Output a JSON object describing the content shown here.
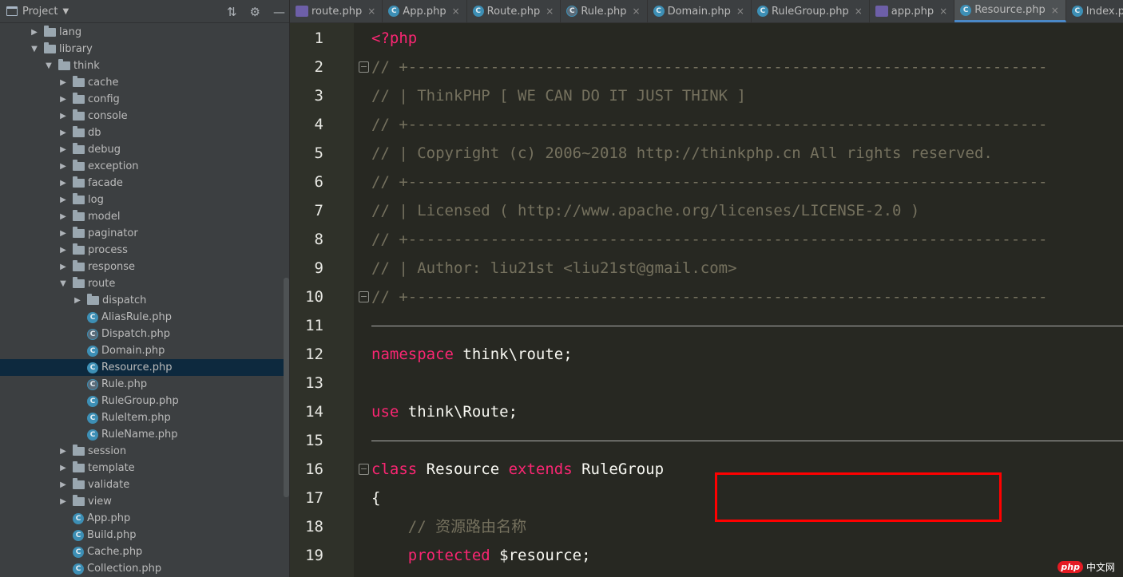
{
  "project": {
    "title": "Project",
    "tree": [
      {
        "label": "lang",
        "type": "folder",
        "depth": 0,
        "expanded": false
      },
      {
        "label": "library",
        "type": "folder",
        "depth": 0,
        "expanded": true
      },
      {
        "label": "think",
        "type": "folder",
        "depth": 1,
        "expanded": true
      },
      {
        "label": "cache",
        "type": "folder",
        "depth": 2,
        "expanded": false
      },
      {
        "label": "config",
        "type": "folder",
        "depth": 2,
        "expanded": false
      },
      {
        "label": "console",
        "type": "folder",
        "depth": 2,
        "expanded": false
      },
      {
        "label": "db",
        "type": "folder",
        "depth": 2,
        "expanded": false
      },
      {
        "label": "debug",
        "type": "folder",
        "depth": 2,
        "expanded": false
      },
      {
        "label": "exception",
        "type": "folder",
        "depth": 2,
        "expanded": false
      },
      {
        "label": "facade",
        "type": "folder",
        "depth": 2,
        "expanded": false
      },
      {
        "label": "log",
        "type": "folder",
        "depth": 2,
        "expanded": false
      },
      {
        "label": "model",
        "type": "folder",
        "depth": 2,
        "expanded": false
      },
      {
        "label": "paginator",
        "type": "folder",
        "depth": 2,
        "expanded": false
      },
      {
        "label": "process",
        "type": "folder",
        "depth": 2,
        "expanded": false
      },
      {
        "label": "response",
        "type": "folder",
        "depth": 2,
        "expanded": false
      },
      {
        "label": "route",
        "type": "folder",
        "depth": 2,
        "expanded": true
      },
      {
        "label": "dispatch",
        "type": "folder",
        "depth": 3,
        "expanded": false
      },
      {
        "label": "AliasRule.php",
        "type": "class",
        "depth": 3
      },
      {
        "label": "Dispatch.php",
        "type": "abstract",
        "depth": 3
      },
      {
        "label": "Domain.php",
        "type": "class",
        "depth": 3
      },
      {
        "label": "Resource.php",
        "type": "class",
        "depth": 3,
        "selected": true
      },
      {
        "label": "Rule.php",
        "type": "abstract",
        "depth": 3
      },
      {
        "label": "RuleGroup.php",
        "type": "class",
        "depth": 3
      },
      {
        "label": "RuleItem.php",
        "type": "class",
        "depth": 3
      },
      {
        "label": "RuleName.php",
        "type": "class",
        "depth": 3
      },
      {
        "label": "session",
        "type": "folder",
        "depth": 2,
        "expanded": false
      },
      {
        "label": "template",
        "type": "folder",
        "depth": 2,
        "expanded": false
      },
      {
        "label": "validate",
        "type": "folder",
        "depth": 2,
        "expanded": false
      },
      {
        "label": "view",
        "type": "folder",
        "depth": 2,
        "expanded": false
      },
      {
        "label": "App.php",
        "type": "class",
        "depth": 2
      },
      {
        "label": "Build.php",
        "type": "class",
        "depth": 2
      },
      {
        "label": "Cache.php",
        "type": "class",
        "depth": 2
      },
      {
        "label": "Collection.php",
        "type": "class",
        "depth": 2
      }
    ]
  },
  "tabs": [
    {
      "label": "route.php",
      "icon": "php"
    },
    {
      "label": "App.php",
      "icon": "class"
    },
    {
      "label": "Route.php",
      "icon": "class"
    },
    {
      "label": "Rule.php",
      "icon": "abstract"
    },
    {
      "label": "Domain.php",
      "icon": "class"
    },
    {
      "label": "RuleGroup.php",
      "icon": "class"
    },
    {
      "label": "app.php",
      "icon": "php"
    },
    {
      "label": "Resource.php",
      "icon": "class",
      "active": true
    },
    {
      "label": "Index.php",
      "icon": "class"
    }
  ],
  "tab_close_glyph": "×",
  "editor": {
    "lines": [
      {
        "n": "1",
        "tokens": [
          {
            "t": "<?php",
            "c": "kw"
          }
        ]
      },
      {
        "n": "2",
        "fold": true,
        "tokens": [
          {
            "t": "// +----------------------------------------------------------------------",
            "c": "comment"
          }
        ]
      },
      {
        "n": "3",
        "tokens": [
          {
            "t": "// | ThinkPHP [ WE CAN DO IT JUST THINK ]",
            "c": "comment"
          }
        ]
      },
      {
        "n": "4",
        "tokens": [
          {
            "t": "// +----------------------------------------------------------------------",
            "c": "comment"
          }
        ]
      },
      {
        "n": "5",
        "tokens": [
          {
            "t": "// | Copyright (c) 2006~2018 http://thinkphp.cn All rights reserved.",
            "c": "comment"
          }
        ]
      },
      {
        "n": "6",
        "tokens": [
          {
            "t": "// +----------------------------------------------------------------------",
            "c": "comment"
          }
        ]
      },
      {
        "n": "7",
        "tokens": [
          {
            "t": "// | Licensed ( http://www.apache.org/licenses/LICENSE-2.0 )",
            "c": "comment"
          }
        ]
      },
      {
        "n": "8",
        "tokens": [
          {
            "t": "// +----------------------------------------------------------------------",
            "c": "comment"
          }
        ]
      },
      {
        "n": "9",
        "tokens": [
          {
            "t": "// | Author: liu21st <liu21st@gmail.com>",
            "c": "comment"
          }
        ]
      },
      {
        "n": "10",
        "fold": true,
        "tokens": [
          {
            "t": "// +----------------------------------------------------------------------",
            "c": "comment"
          }
        ]
      },
      {
        "n": "11",
        "tokens": []
      },
      {
        "n": "12",
        "tokens": [
          {
            "t": "namespace",
            "c": "kw"
          },
          {
            "t": " think\\route;",
            "c": "plain"
          }
        ]
      },
      {
        "n": "13",
        "tokens": []
      },
      {
        "n": "14",
        "tokens": [
          {
            "t": "use",
            "c": "kw"
          },
          {
            "t": " think\\Route;",
            "c": "plain"
          }
        ]
      },
      {
        "n": "15",
        "tokens": []
      },
      {
        "n": "16",
        "fold": true,
        "tokens": [
          {
            "t": "class",
            "c": "kw"
          },
          {
            "t": " Resource ",
            "c": "plain"
          },
          {
            "t": "extends",
            "c": "kw"
          },
          {
            "t": " RuleGroup",
            "c": "plain"
          }
        ]
      },
      {
        "n": "17",
        "tokens": [
          {
            "t": "{",
            "c": "plain"
          }
        ]
      },
      {
        "n": "18",
        "tokens": [
          {
            "t": "    // 资源路由名称",
            "c": "comment"
          }
        ]
      },
      {
        "n": "19",
        "tokens": [
          {
            "t": "    ",
            "c": "plain"
          },
          {
            "t": "protected",
            "c": "kw"
          },
          {
            "t": " $resource;",
            "c": "plain"
          }
        ]
      }
    ]
  },
  "watermark": {
    "logo": "php",
    "text": "中文网"
  }
}
